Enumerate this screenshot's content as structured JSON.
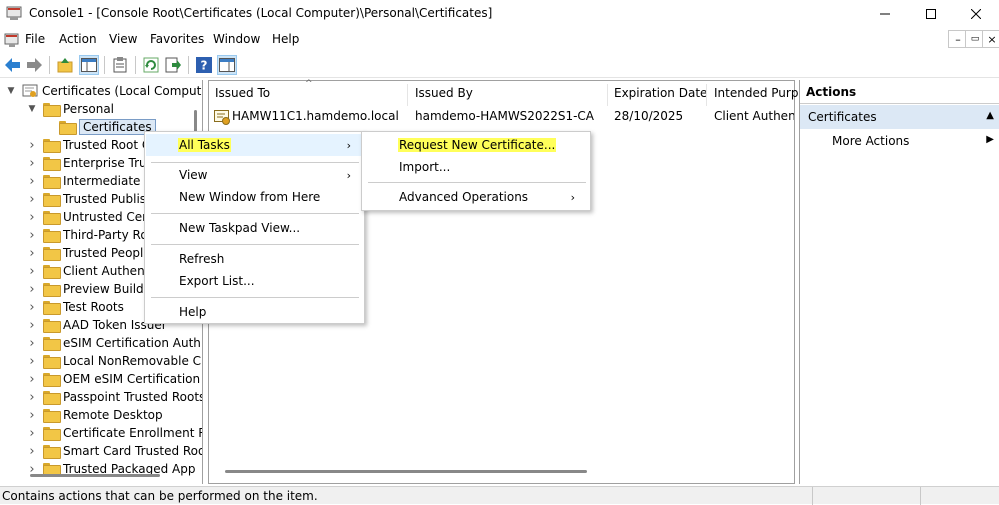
{
  "window": {
    "title": "Console1 - [Console Root\\Certificates (Local Computer)\\Personal\\Certificates]"
  },
  "menubar": [
    "File",
    "Action",
    "View",
    "Favorites",
    "Window",
    "Help"
  ],
  "tree": {
    "root": "Certificates (Local Comput",
    "personal": "Personal",
    "certificates": "Certificates",
    "stores": [
      "Trusted Root C",
      "Enterprise Trust",
      "Intermediate C",
      "Trusted Publish",
      "Untrusted Cert",
      "Third-Party Roo",
      "Trusted People",
      "Client Authent",
      "Preview Build F",
      "Test Roots",
      "AAD Token Issuer",
      "eSIM Certification Auth",
      "Local NonRemovable C",
      "OEM eSIM Certification",
      "Passpoint Trusted Roots",
      "Remote Desktop",
      "Certificate Enrollment R",
      "Smart Card Trusted Roo",
      "Trusted Packaged App"
    ]
  },
  "list": {
    "columns": [
      "Issued To",
      "Issued By",
      "Expiration Date",
      "Intended Purpo"
    ],
    "rows": [
      {
        "issued_to": "HAMW11C1.hamdemo.local",
        "issued_by": "hamdemo-HAMWS2022S1-CA",
        "expiration": "28/10/2025",
        "purpose": "Client Authenti"
      }
    ]
  },
  "actions": {
    "header": "Actions",
    "section": "Certificates",
    "more": "More Actions"
  },
  "context_menu": {
    "all_tasks": "All Tasks",
    "view": "View",
    "new_window": "New Window from Here",
    "new_taskpad": "New Taskpad View...",
    "refresh": "Refresh",
    "export_list": "Export List...",
    "help": "Help"
  },
  "submenu": {
    "request_new": "Request New Certificate...",
    "import": "Import...",
    "advanced": "Advanced Operations"
  },
  "status": "Contains actions that can be performed on the item.",
  "colors": {
    "highlight": "#ffff5a",
    "actions_section_bg": "#dce8f5",
    "status_bar": "#f0f0f0"
  }
}
